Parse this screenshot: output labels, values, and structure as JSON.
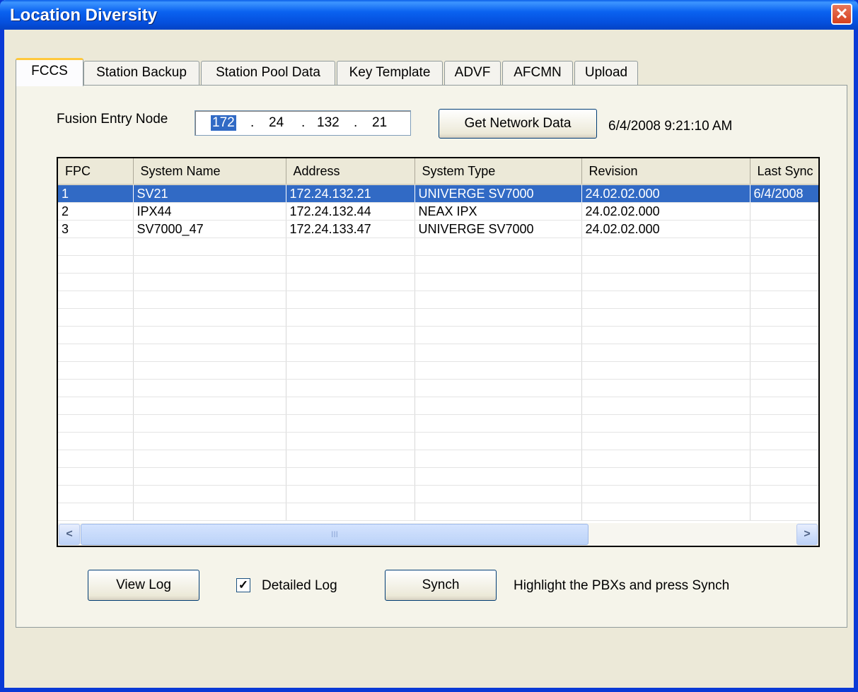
{
  "window": {
    "title": "Location Diversity",
    "close_glyph": "✕"
  },
  "tabs": [
    {
      "label": "FCCS",
      "active": true
    },
    {
      "label": "Station Backup"
    },
    {
      "label": "Station Pool Data"
    },
    {
      "label": "Key Template"
    },
    {
      "label": "ADVF"
    },
    {
      "label": "AFCMN"
    },
    {
      "label": "Upload"
    }
  ],
  "fcc": {
    "entry_node_label": "Fusion Entry Node",
    "ip_octets": [
      "172",
      "24",
      "132",
      "21"
    ],
    "ip_separator": ".",
    "get_network_button": "Get Network Data",
    "timestamp": "6/4/2008 9:21:10 AM"
  },
  "grid": {
    "columns": [
      "FPC",
      "System Name",
      "Address",
      "System Type",
      "Revision",
      "Last Sync"
    ],
    "rows": [
      [
        "1",
        "SV21",
        "172.24.132.21",
        "UNIVERGE SV7000",
        "24.02.02.000",
        "6/4/2008"
      ],
      [
        "2",
        "IPX44",
        "172.24.132.44",
        "NEAX IPX",
        "24.02.02.000",
        ""
      ],
      [
        "3",
        "SV7000_47",
        "172.24.133.47",
        "UNIVERGE SV7000",
        "24.02.02.000",
        ""
      ]
    ],
    "selected_row": 0,
    "empty_rows": 16
  },
  "scrollbar": {
    "left_glyph": "<",
    "right_glyph": ">",
    "thumb_glyph": "III"
  },
  "footer": {
    "view_log_button": "View Log",
    "detailed_log_label": "Detailed Log",
    "detailed_log_checked": true,
    "check_glyph": "✓",
    "synch_button": "Synch",
    "hint": "Highlight the PBXs and press Synch"
  }
}
